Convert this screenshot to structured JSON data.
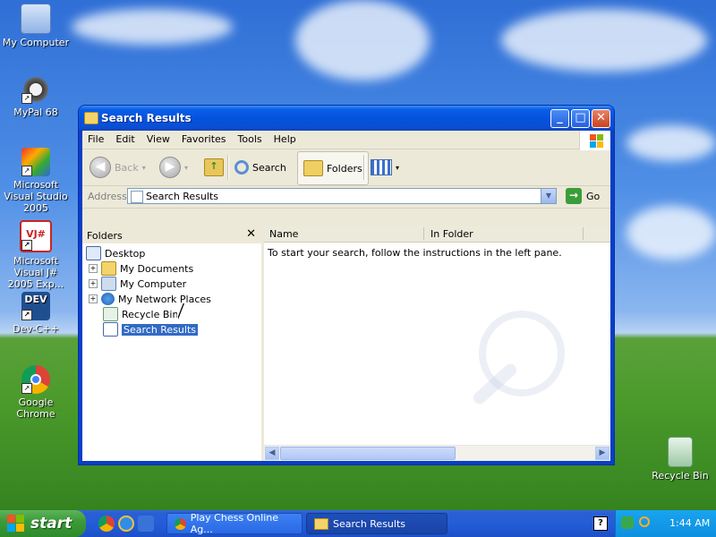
{
  "desktop": {
    "icons": [
      {
        "label": "My Computer",
        "icon": "computer-icon"
      },
      {
        "label": "MyPal 68",
        "icon": "raccoon-icon"
      },
      {
        "label": "Microsoft Visual Studio 2005",
        "icon": "visual-studio-icon"
      },
      {
        "label": "Microsoft Visual J# 2005 Exp...",
        "icon": "vj-icon"
      },
      {
        "label": "Dev-C++",
        "icon": "dev-cpp-icon"
      },
      {
        "label": "Google Chrome",
        "icon": "chrome-icon"
      },
      {
        "label": "Recycle Bin",
        "icon": "recycle-bin-icon"
      }
    ]
  },
  "window": {
    "title": "Search Results",
    "menu": [
      "File",
      "Edit",
      "View",
      "Favorites",
      "Tools",
      "Help"
    ],
    "toolbar": {
      "back_label": "Back",
      "search_label": "Search",
      "folders_label": "Folders"
    },
    "address": {
      "label": "Address",
      "value": "Search Results",
      "go_label": "Go"
    },
    "folders_pane": {
      "title": "Folders",
      "tree": [
        {
          "label": "Desktop",
          "icon": "desktop-icon"
        },
        {
          "label": "My Documents",
          "icon": "my-documents-icon"
        },
        {
          "label": "My Computer",
          "icon": "computer-icon"
        },
        {
          "label": "My Network Places",
          "icon": "network-icon"
        },
        {
          "label": "Recycle Bin",
          "icon": "recycle-bin-icon"
        },
        {
          "label": "Search Results",
          "icon": "search-results-icon"
        }
      ]
    },
    "content": {
      "columns": [
        "Name",
        "In Folder"
      ],
      "message": "To start your search, follow the instructions in the left pane."
    }
  },
  "taskbar": {
    "start_label": "start",
    "tasks": [
      {
        "label": "Play Chess Online Ag...",
        "icon": "chrome-icon"
      },
      {
        "label": "Search Results",
        "icon": "folder-search-icon"
      }
    ],
    "clock": "1:44 AM"
  },
  "colors": {
    "titlebar": "#0452dc",
    "selection": "#316ac5",
    "start_green": "#3c9b38",
    "tray": "#0e8fdf"
  }
}
